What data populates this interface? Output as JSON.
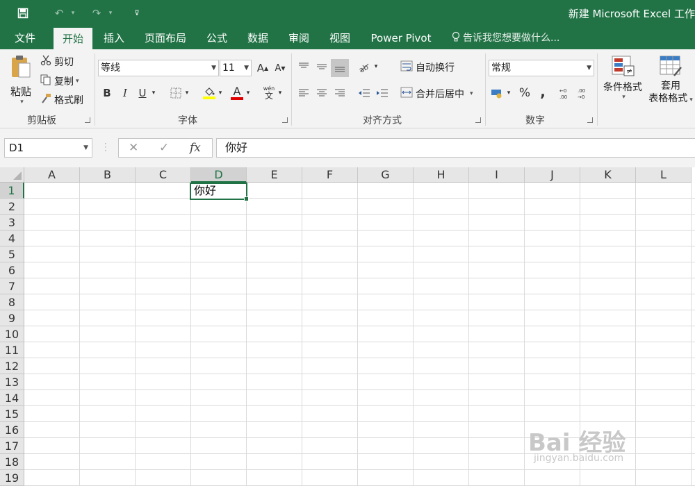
{
  "titlebar": {
    "title": "新建 Microsoft Excel 工作",
    "quick_access": {
      "save_icon": "save-icon",
      "undo_icon": "undo-icon",
      "redo_icon": "redo-icon",
      "customize_icon": "customize-icon"
    }
  },
  "tabs": [
    {
      "label": "文件"
    },
    {
      "label": "开始",
      "active": true
    },
    {
      "label": "插入"
    },
    {
      "label": "页面布局"
    },
    {
      "label": "公式"
    },
    {
      "label": "数据"
    },
    {
      "label": "审阅"
    },
    {
      "label": "视图"
    },
    {
      "label": "Power Pivot"
    }
  ],
  "tell_me": "告诉我您想要做什么...",
  "ribbon": {
    "clipboard": {
      "label": "剪贴板",
      "paste": "粘贴",
      "cut": "剪切",
      "copy": "复制",
      "format_painter": "格式刷"
    },
    "font": {
      "label": "字体",
      "font_name": "等线",
      "font_size": "11",
      "bold": "B",
      "italic": "I",
      "underline": "U",
      "font_color_letter": "A",
      "font_color": "#e00000",
      "highlight_color": "#ffff00",
      "phonetic_top": "wén",
      "phonetic_bottom": "文"
    },
    "alignment": {
      "label": "对齐方式",
      "wrap_text": "自动换行",
      "merge_center": "合并后居中"
    },
    "number": {
      "label": "数字",
      "format": "常规",
      "percent": "%",
      "comma": ","
    },
    "styles": {
      "conditional_format": "条件格式",
      "table_format_1": "套用",
      "table_format_2": "表格格式"
    }
  },
  "formula_bar": {
    "name_box": "D1",
    "cancel": "✕",
    "enter": "✓",
    "fx": "fx",
    "content": "你好"
  },
  "sheet": {
    "columns": [
      "A",
      "B",
      "C",
      "D",
      "E",
      "F",
      "G",
      "H",
      "I",
      "J",
      "K",
      "L"
    ],
    "selected_column": "D",
    "rows": [
      "1",
      "2",
      "3",
      "4",
      "5",
      "6",
      "7",
      "8",
      "9",
      "10",
      "11",
      "12",
      "13",
      "14",
      "15",
      "16",
      "17",
      "18",
      "19"
    ],
    "selected_row": "1",
    "active_cell_value": "你好"
  },
  "watermark": {
    "logo": "Bai 经验",
    "url": "jingyan.baidu.com"
  },
  "colors": {
    "accent": "#217346"
  }
}
